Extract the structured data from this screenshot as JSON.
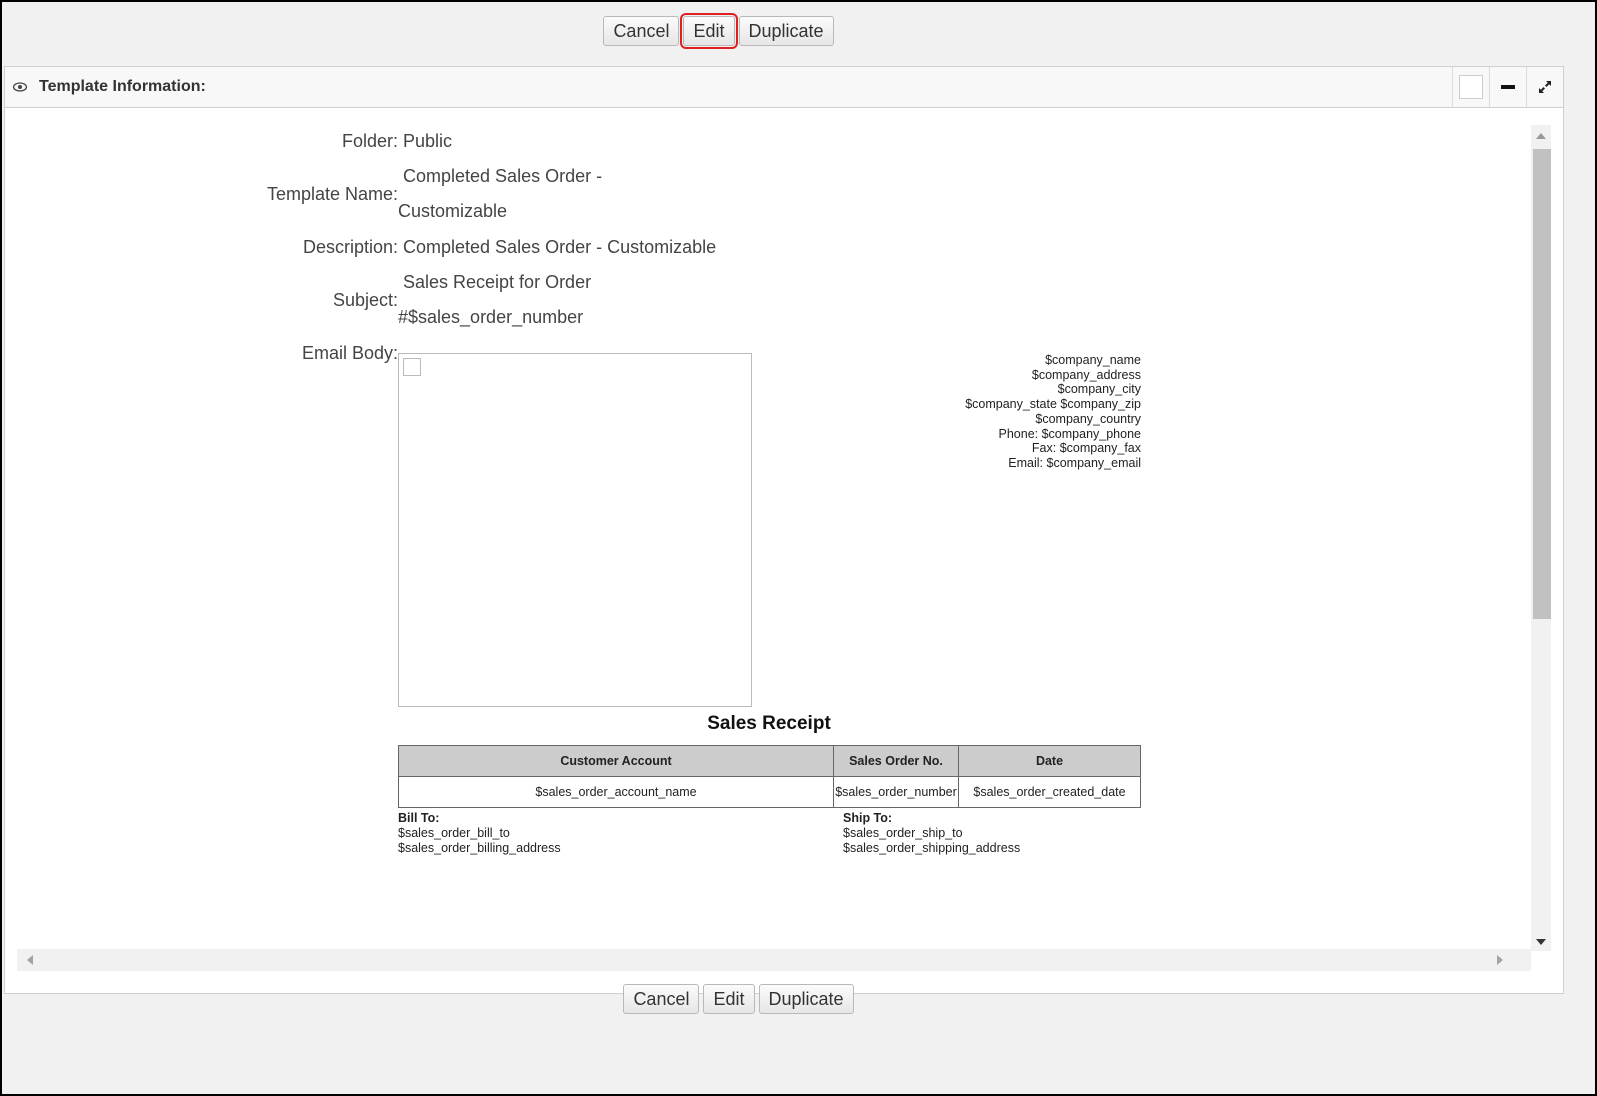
{
  "toolbar": {
    "cancel": "Cancel",
    "edit": "Edit",
    "duplicate": "Duplicate"
  },
  "panel": {
    "title": "Template Information:"
  },
  "fields": {
    "folder_label": "Folder:",
    "folder_value": "Public",
    "template_name_label": "Template Name:",
    "template_name_line1": "Completed Sales Order -",
    "template_name_line2": "Customizable",
    "description_label": "Description:",
    "description_value": "Completed Sales Order - Customizable",
    "subject_label": "Subject:",
    "subject_line1": "Sales Receipt for Order",
    "subject_line2": "#$sales_order_number",
    "email_body_label": "Email Body:"
  },
  "company": [
    "$company_name",
    "$company_address",
    "$company_city",
    "$company_state $company_zip",
    "$company_country",
    "Phone: $company_phone",
    "Fax: $company_fax",
    "Email: $company_email"
  ],
  "receipt": {
    "title": "Sales Receipt",
    "headers": [
      "Customer Account",
      "Sales Order No.",
      "Date"
    ],
    "row": [
      "$sales_order_account_name",
      "$sales_order_number",
      "$sales_order_created_date"
    ],
    "bill_to_label": "Bill To:",
    "bill_to_line1": "$sales_order_bill_to",
    "bill_to_line2": "$sales_order_billing_address",
    "ship_to_label": "Ship To:",
    "ship_to_line1": "$sales_order_ship_to",
    "ship_to_line2": "$sales_order_shipping_address"
  }
}
